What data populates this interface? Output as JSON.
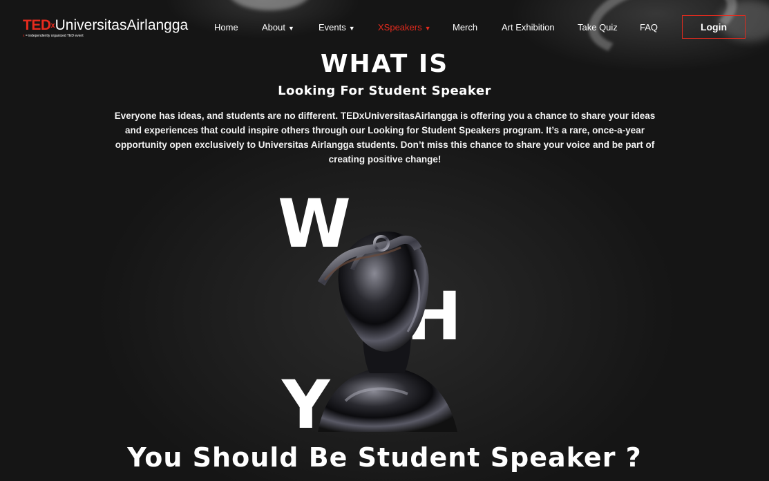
{
  "brand": {
    "ted": "TED",
    "x": "x",
    "name": "UniversitasAirlangga",
    "tag_x": "x",
    "tagline": " = independently organized TED event"
  },
  "nav": {
    "home": "Home",
    "about": "About",
    "events": "Events",
    "xspeakers": "XSpeakers",
    "merch": "Merch",
    "art_exhibition": "Art Exhibition",
    "take_quiz": "Take Quiz",
    "faq": "FAQ",
    "login": "Login"
  },
  "main": {
    "heading": "WHAT IS",
    "subheading": "Looking For Student Speaker",
    "paragraph": "Everyone has ideas, and students are no different. TEDxUniversitasAirlangga is offering you a chance to share your ideas and experiences that could inspire others through our Looking for Student Speakers program. It’s a rare, once-a-year opportunity open exclusively to Universitas Airlangga students. Don’t miss this chance to share your voice and be part of creating positive change!",
    "why_w": "W",
    "why_h": "H",
    "why_y": "Y",
    "bottom_title": "You Should Be Student Speaker ?"
  },
  "colors": {
    "accent": "#e62b1e",
    "background": "#151515",
    "text": "#ffffff"
  },
  "icons": {
    "caret": "caret-down-icon"
  }
}
